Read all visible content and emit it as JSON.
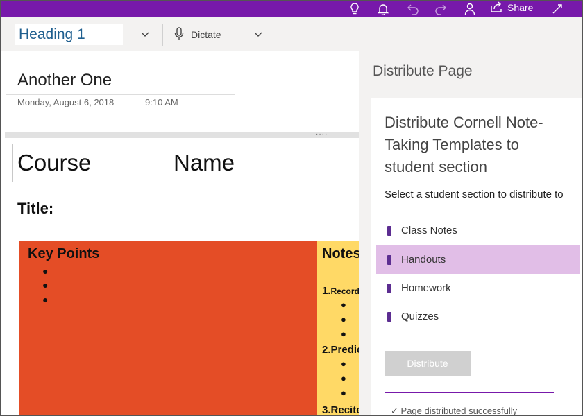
{
  "titlebar": {
    "share_label": "Share",
    "icons": [
      "lightbulb-icon",
      "bell-icon",
      "undo-icon",
      "redo-icon",
      "person-icon",
      "share-icon",
      "expand-icon"
    ]
  },
  "ribbon": {
    "style_value": "Heading 1",
    "dictate_label": "Dictate"
  },
  "page": {
    "title": "Another One",
    "date": "Monday, August 6, 2018",
    "time": "9:10 AM",
    "table": {
      "course": "Course",
      "name": "Name"
    },
    "title_field": "Title:",
    "key_points": {
      "heading": "Key Points"
    },
    "notes": {
      "heading": "Notes",
      "items": [
        {
          "number": "1.",
          "text": "Record"
        },
        {
          "number": "2.",
          "text": "Predict"
        },
        {
          "number": "3.",
          "text": "Recite"
        }
      ]
    }
  },
  "panel": {
    "title": "Distribute Page",
    "card_title": "Distribute Cornell Note-Taking Templates to student section",
    "subtitle": "Select a student section to distribute to",
    "sections": [
      {
        "label": "Class Notes",
        "selected": false
      },
      {
        "label": "Handouts",
        "selected": true
      },
      {
        "label": "Homework",
        "selected": false
      },
      {
        "label": "Quizzes",
        "selected": false
      }
    ],
    "distribute_label": "Distribute",
    "status": "Page distributed successfully"
  },
  "colors": {
    "onenote_purple": "#7719aa",
    "key_points_bg": "#e44d26",
    "notes_bg": "#ffd966",
    "selected_section": "#e1bee7",
    "section_icon": "#5c2d91"
  }
}
